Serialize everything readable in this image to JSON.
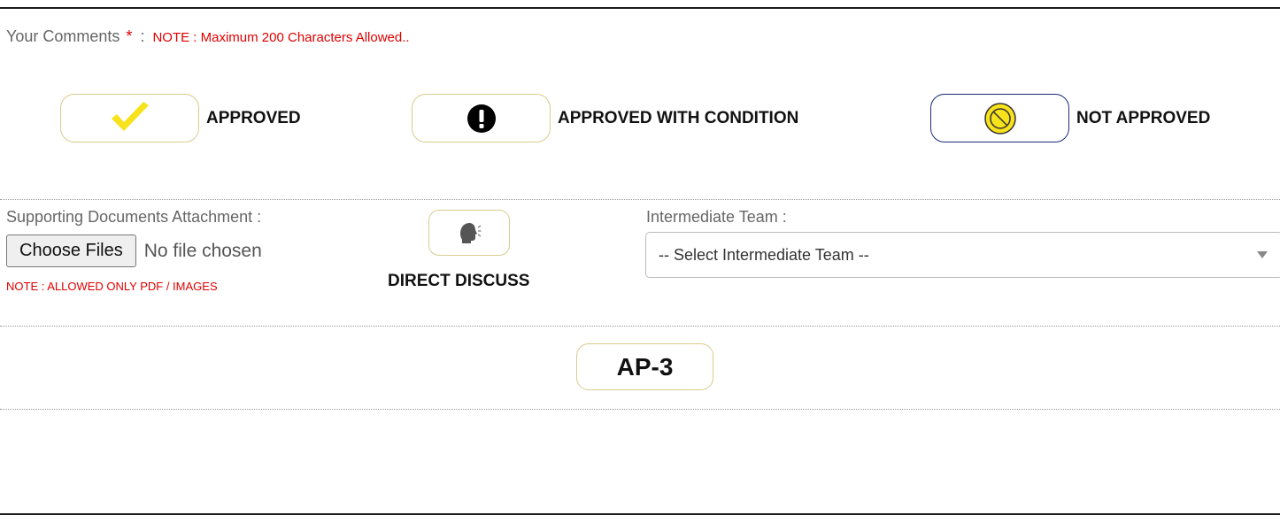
{
  "comments": {
    "label": "Your Comments",
    "required_mark": "*",
    "separator": ":",
    "note": "NOTE : Maximum 200 Characters Allowed.."
  },
  "status_options": [
    {
      "label": "APPROVED",
      "icon": "check-icon",
      "color": "#f7e21b",
      "selected": false
    },
    {
      "label": "APPROVED WITH CONDITION",
      "icon": "exclamation-icon",
      "color": "#000000",
      "selected": false
    },
    {
      "label": "NOT APPROVED",
      "icon": "prohibited-icon",
      "color": "#f7e21b",
      "selected": true
    }
  ],
  "attachment": {
    "label": "Supporting Documents Attachment :",
    "button_label": "Choose Files",
    "status": "No file chosen",
    "note": "NOTE : ALLOWED ONLY PDF / IMAGES"
  },
  "direct_discuss": {
    "label": "DIRECT DISCUSS",
    "icon": "speaking-head-icon"
  },
  "intermediate_team": {
    "label": "Intermediate Team :",
    "selected": "-- Select Intermediate Team --"
  },
  "submit": {
    "label": "AP-3"
  },
  "colors": {
    "accent_border": "#d8cc8e",
    "selected_border": "#1b2a78",
    "note_red": "#e00000"
  }
}
